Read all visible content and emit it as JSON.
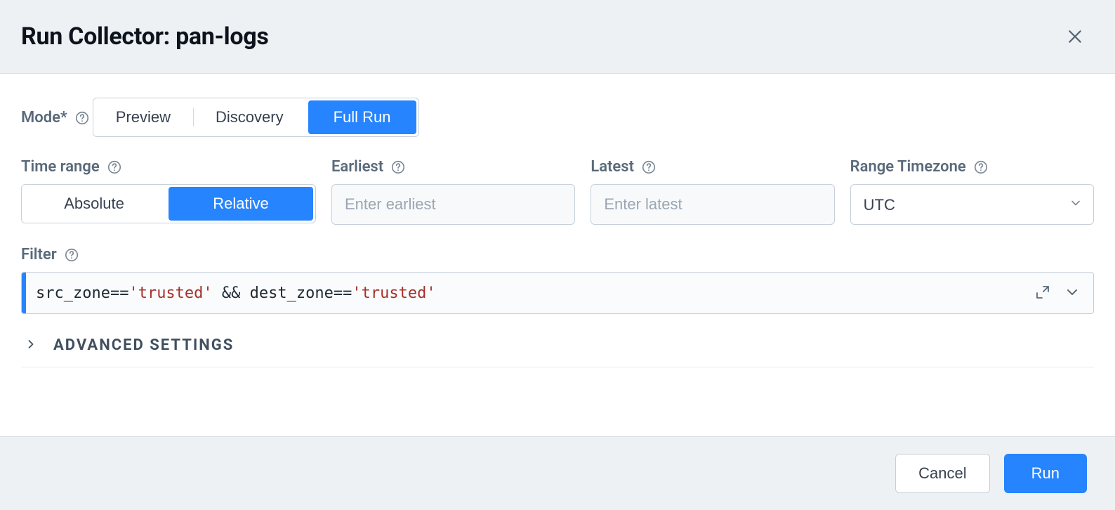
{
  "dialog": {
    "title": "Run Collector: pan-logs"
  },
  "mode": {
    "label": "Mode*",
    "options": [
      "Preview",
      "Discovery",
      "Full Run"
    ],
    "selected": "Full Run"
  },
  "timerange": {
    "label": "Time range",
    "options": [
      "Absolute",
      "Relative"
    ],
    "selected": "Relative"
  },
  "earliest": {
    "label": "Earliest",
    "placeholder": "Enter earliest",
    "value": ""
  },
  "latest": {
    "label": "Latest",
    "placeholder": "Enter latest",
    "value": ""
  },
  "timezone": {
    "label": "Range Timezone",
    "value": "UTC"
  },
  "filter": {
    "label": "Filter",
    "expression_plain": "src_zone=='trusted' && dest_zone=='trusted'",
    "expression_tokens": [
      {
        "t": "plain",
        "v": "src_zone=="
      },
      {
        "t": "str",
        "v": "'trusted'"
      },
      {
        "t": "plain",
        "v": " && dest_zone=="
      },
      {
        "t": "str",
        "v": "'trusted'"
      }
    ]
  },
  "advanced": {
    "label": "ADVANCED SETTINGS"
  },
  "footer": {
    "cancel": "Cancel",
    "run": "Run"
  }
}
